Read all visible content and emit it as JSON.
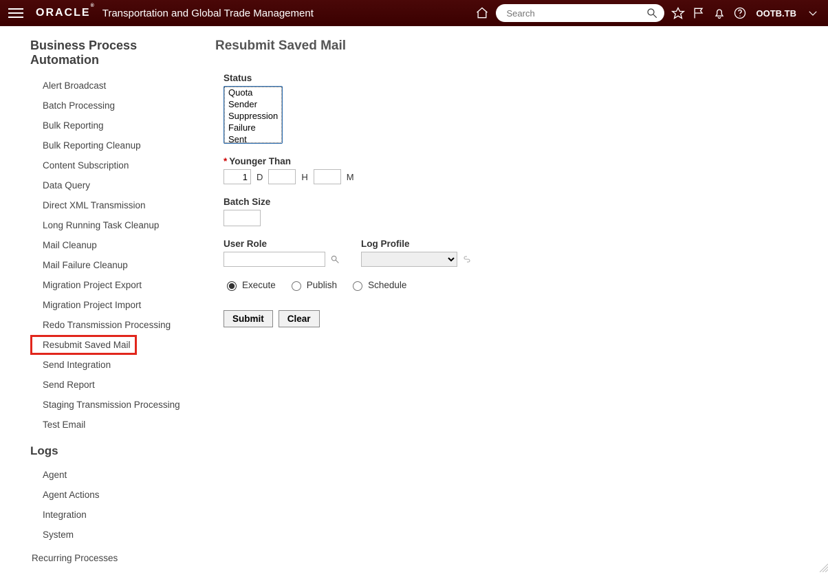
{
  "header": {
    "logo": "ORACLE",
    "app_title": "Transportation and Global Trade Management",
    "search_placeholder": "Search",
    "user": "OOTB.TB"
  },
  "sidebar": {
    "section1_title": "Business Process Automation",
    "items1": [
      "Alert Broadcast",
      "Batch Processing",
      "Bulk Reporting",
      "Bulk Reporting Cleanup",
      "Content Subscription",
      "Data Query",
      "Direct XML Transmission",
      "Long Running Task Cleanup",
      "Mail Cleanup",
      "Mail Failure Cleanup",
      "Migration Project Export",
      "Migration Project Import",
      "Redo Transmission Processing",
      "Resubmit Saved Mail",
      "Send Integration",
      "Send Report",
      "Staging Transmission Processing",
      "Test Email"
    ],
    "active_index1": 13,
    "section2_title": "Logs",
    "items2": [
      "Agent",
      "Agent Actions",
      "Integration",
      "System"
    ],
    "recurring": "Recurring Processes"
  },
  "page": {
    "title": "Resubmit Saved Mail",
    "status_label": "Status",
    "status_options": [
      "Quota",
      "Sender",
      "Suppression",
      "Failure",
      "Sent"
    ],
    "younger_than_label": "Younger Than",
    "younger_than": {
      "d": "1",
      "h": "",
      "m": ""
    },
    "units": {
      "d": "D",
      "h": "H",
      "m": "M"
    },
    "batch_size_label": "Batch Size",
    "batch_size": "",
    "user_role_label": "User Role",
    "user_role": "",
    "log_profile_label": "Log Profile",
    "log_profile": "",
    "radios": {
      "execute": "Execute",
      "publish": "Publish",
      "schedule": "Schedule"
    },
    "radio_selected": "execute",
    "submit": "Submit",
    "clear": "Clear"
  }
}
